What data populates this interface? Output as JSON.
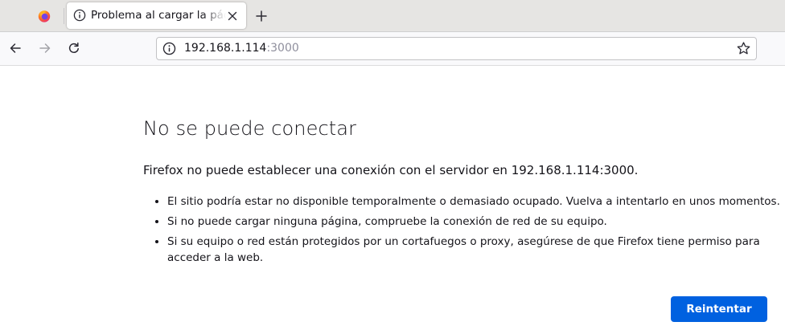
{
  "browser": {
    "tab": {
      "title": "Problema al cargar la página"
    },
    "url": {
      "host": "192.168.1.114",
      "port": ":3000"
    }
  },
  "icons": {
    "pinned_tab": "firefox-logo",
    "tab_status": "info-icon",
    "tab_close": "close-icon",
    "new_tab": "plus-icon",
    "back": "arrow-left-icon",
    "forward": "arrow-right-icon",
    "reload": "reload-icon",
    "url_status": "info-icon",
    "bookmark": "star-icon"
  },
  "error": {
    "title": "No se puede conectar",
    "description": "Firefox no puede establecer una conexión con el servidor en 192.168.1.114:3000.",
    "suggestions": [
      "El sitio podría estar no disponible temporalmente o demasiado ocupado. Vuelva a intentarlo en unos momentos.",
      "Si no puede cargar ninguna página, compruebe la conexión de red de su equipo.",
      "Si su equipo o red están protegidos por un cortafuegos o proxy, asegúrese de que Firefox tiene permiso para acceder a la web."
    ],
    "retry_label": "Reintentar"
  },
  "colors": {
    "accent_button": "#0061e0",
    "tabstrip_bg": "#e6e5e3",
    "navbar_bg": "#f9f9fb",
    "port_text": "#8f8f9d"
  }
}
